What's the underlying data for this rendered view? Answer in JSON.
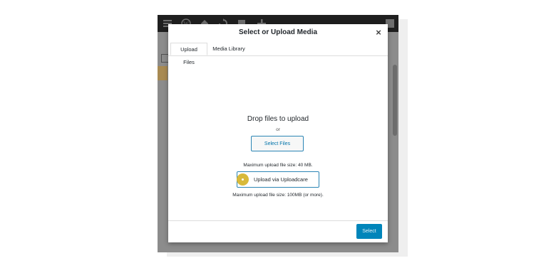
{
  "modal": {
    "title": "Select or Upload Media",
    "close_symbol": "×",
    "tabs": [
      {
        "label": "Upload Files",
        "active": true
      },
      {
        "label": "Media Library",
        "active": false
      }
    ]
  },
  "uploader": {
    "drop_text": "Drop files to upload",
    "or_text": "or",
    "select_files_label": "Select Files",
    "max_upload_text": "Maximum upload file size: 40 MB.",
    "uploadcare_label": "Upload via Uploadcare",
    "uploadcare_max_text": "Maximum upload file size: 100MB (or more)."
  },
  "footer": {
    "select_label": "Select"
  },
  "admin_bar": {
    "icons": [
      "menu-icon",
      "wordpress-logo-icon",
      "home-icon",
      "updates-icon",
      "comments-icon",
      "plus-icon",
      "user-avatar-icon"
    ]
  },
  "colors": {
    "primary_button": "#0085ba",
    "accent_border": "#2b85b5",
    "cursor_highlight": "#d8b93a"
  }
}
